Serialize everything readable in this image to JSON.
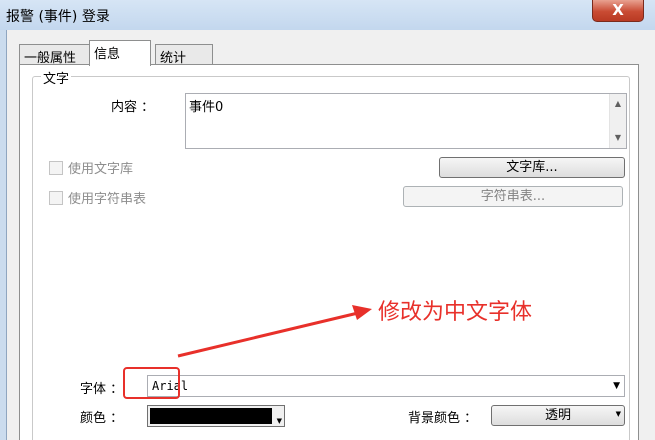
{
  "window": {
    "title": "报警 (事件) 登录",
    "close_label": "X"
  },
  "tabs": [
    {
      "label": "一般属性",
      "active": false
    },
    {
      "label": "信息",
      "active": true
    },
    {
      "label": "统计",
      "active": false
    }
  ],
  "text_group": {
    "legend": "文字",
    "content_label": "内容 ：",
    "content_value": "事件0",
    "use_text_library_label": "使用文字库",
    "use_text_library_checked": false,
    "use_string_table_label": "使用字符串表",
    "use_string_table_checked": false,
    "text_library_button": "文字库...",
    "string_table_button": "字符串表..."
  },
  "font": {
    "label": "字体 ：",
    "value": "Arial"
  },
  "color": {
    "label": "颜色 ：",
    "value": "#000000"
  },
  "background_color": {
    "label": "背景颜色 ：",
    "value": "透明"
  },
  "annotation": {
    "text": "修改为中文字体",
    "color": "#e8302a"
  }
}
